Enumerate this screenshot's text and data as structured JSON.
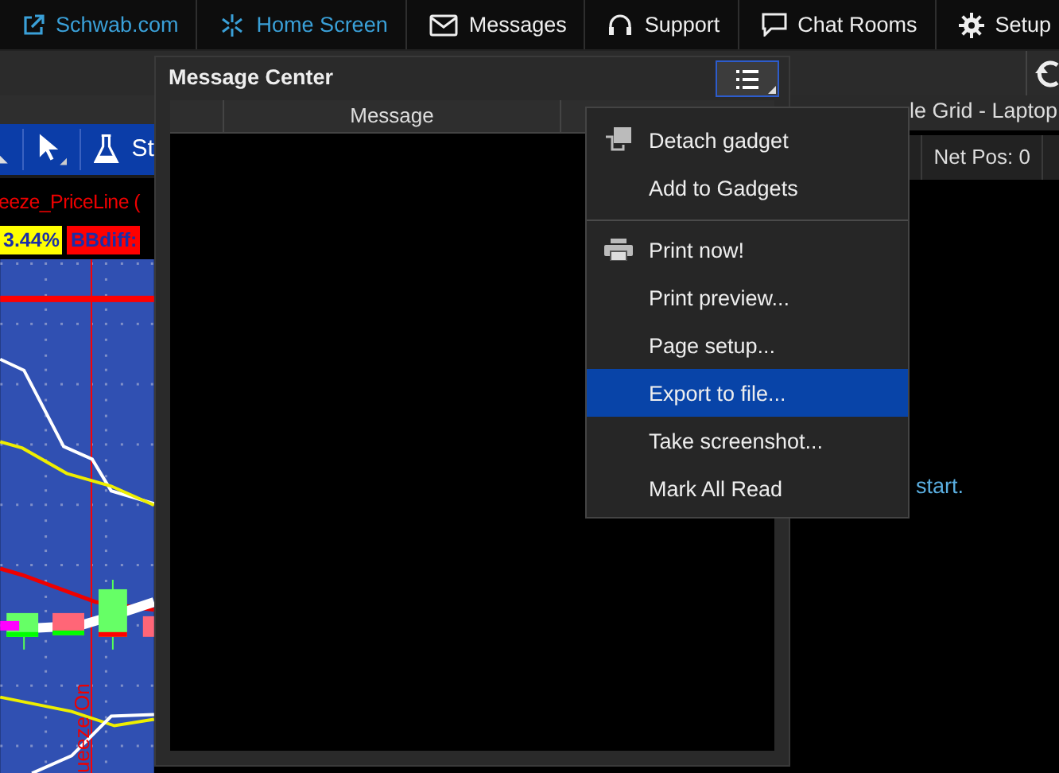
{
  "nav": [
    {
      "label": "Schwab.com",
      "kind": "link"
    },
    {
      "label": "Home Screen",
      "kind": "link"
    },
    {
      "label": "Messages",
      "kind": "menu"
    },
    {
      "label": "Support",
      "kind": "menu"
    },
    {
      "label": "Chat Rooms",
      "kind": "menu"
    },
    {
      "label": "Setup",
      "kind": "menu"
    }
  ],
  "chart": {
    "toolbar_label": "St",
    "study_title": "eeze_PriceLine (",
    "labels": [
      {
        "text": "3.44%",
        "color": "#ffff00"
      },
      {
        "text": "BBdiff:",
        "color": "#ff0000"
      }
    ],
    "marker": "ueeze On"
  },
  "message_center": {
    "title": "Message Center",
    "columns": [
      {
        "label": "Message"
      }
    ]
  },
  "context_menu": {
    "groups": [
      [
        {
          "label": "Detach gadget",
          "selected": false
        },
        {
          "label": "Add to Gadgets",
          "selected": false
        }
      ],
      [
        {
          "label": "Print now!",
          "selected": false
        },
        {
          "label": "Print preview...",
          "selected": false
        },
        {
          "label": "Page setup...",
          "selected": false
        },
        {
          "label": "Export to file...",
          "selected": true
        },
        {
          "label": "Take screenshot...",
          "selected": false
        },
        {
          "label": "Mark All Read",
          "selected": false
        }
      ]
    ]
  },
  "grid_panel": {
    "title": "le Grid - Laptop",
    "net_pos": "Net Pos: 0",
    "hint": "start."
  }
}
